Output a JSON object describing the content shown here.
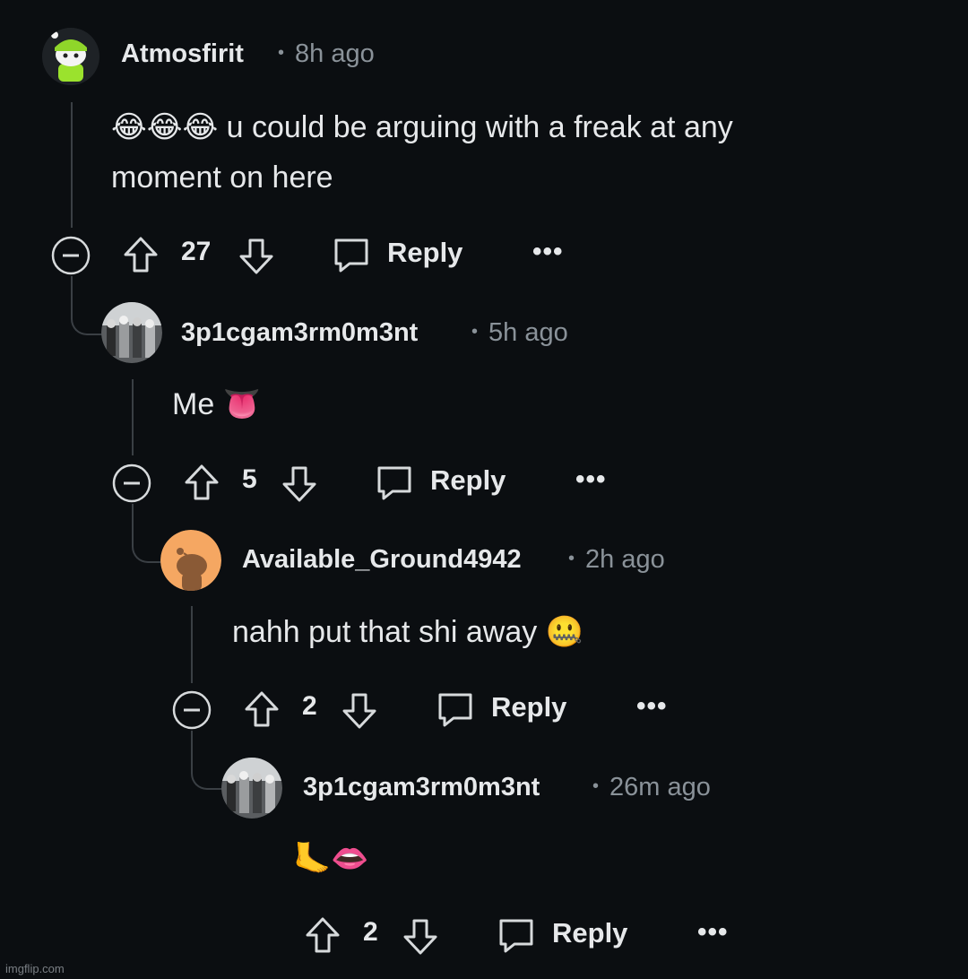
{
  "comments": [
    {
      "username": "Atmosfirit",
      "time": "8h ago",
      "text": "😂😂😂 u could be arguing with a freak at any moment on here",
      "score": "27",
      "reply_label": "Reply"
    },
    {
      "username": "3p1cgam3rm0m3nt",
      "time": "5h ago",
      "text": "Me 👅",
      "score": "5",
      "reply_label": "Reply"
    },
    {
      "username": "Available_Ground4942",
      "time": "2h ago",
      "text": "nahh put that shi away 🤐",
      "score": "2",
      "reply_label": "Reply"
    },
    {
      "username": "3p1cgam3rm0m3nt",
      "time": "26m ago",
      "text": "🦶👄",
      "score": "2",
      "reply_label": "Reply"
    }
  ],
  "more_label": "•••",
  "dot": "•",
  "watermark": "imgflip.com",
  "colors": {
    "background": "#0b0e11",
    "text": "#e6e8ea",
    "muted": "#8a9299",
    "thread": "#3a3f44"
  }
}
